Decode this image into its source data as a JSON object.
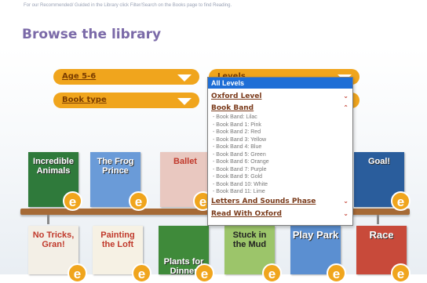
{
  "header": {
    "note": "For our Recommended/ Guided in the Library click Filter/Search on the Books page to find Reading.",
    "title": "Browse the library"
  },
  "filters": {
    "age": "Age 5-6",
    "book_type": "Book type",
    "levels": "Levels"
  },
  "levels_menu": {
    "selected": "All Levels",
    "groups": [
      "Oxford Level",
      "Book Band",
      "Letters And Sounds Phase",
      "Read With Oxford"
    ],
    "book_band_options": [
      "- Book Band: Lilac",
      "- Book Band 1: Pink",
      "- Book Band 2: Red",
      "- Book Band 3: Yellow",
      "- Book Band 4: Blue",
      "- Book Band 5: Green",
      "- Book Band 6: Orange",
      "- Book Band 7: Purple",
      "- Book Band 9: Gold",
      "- Book Band 10: White",
      "- Book Band 11: Lime"
    ]
  },
  "books_top": [
    {
      "title": "Incredible Animals",
      "color": "#2f7a3b"
    },
    {
      "title": "The Frog Prince",
      "color": "#6a9bd8"
    },
    {
      "title": "Ballet",
      "color": "#e9c8c0"
    },
    {
      "title": "Goal!",
      "color": "#2a5d9c"
    }
  ],
  "books_bottom": [
    {
      "title": "No Tricks, Gran!",
      "color": "#f3efe6"
    },
    {
      "title": "Painting the Loft",
      "color": "#f6f1e4"
    },
    {
      "title": "Plants for Dinner",
      "color": "#3f8a3a"
    },
    {
      "title": "Stuck in the Mud",
      "color": "#9cc56a"
    },
    {
      "title": "Play Park",
      "color": "#5b8fd1"
    },
    {
      "title": "Race",
      "color": "#c84a3a"
    }
  ],
  "badge_letter": "e"
}
